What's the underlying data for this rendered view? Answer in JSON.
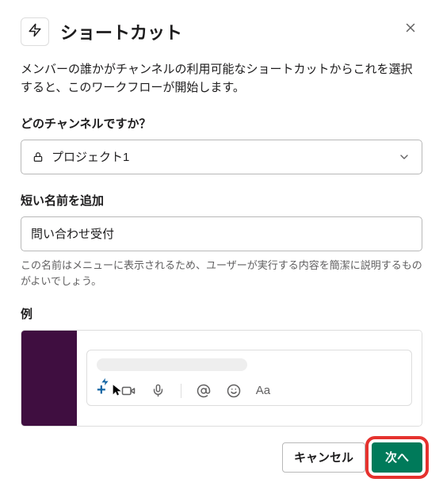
{
  "header": {
    "title": "ショートカット"
  },
  "description": "メンバーの誰かがチャンネルの利用可能なショートカットからこれを選択すると、このワークフローが開始します。",
  "channel": {
    "label": "どのチャンネルですか？",
    "selected": "プロジェクト1"
  },
  "name": {
    "label": "短い名前を追加",
    "value": "問い合わせ受付",
    "help": "この名前はメニューに表示されるため、ユーザーが実行する内容を簡潔に説明するものがよいでしょう。"
  },
  "example": {
    "label": "例"
  },
  "footer": {
    "cancel": "キャンセル",
    "next": "次へ"
  }
}
